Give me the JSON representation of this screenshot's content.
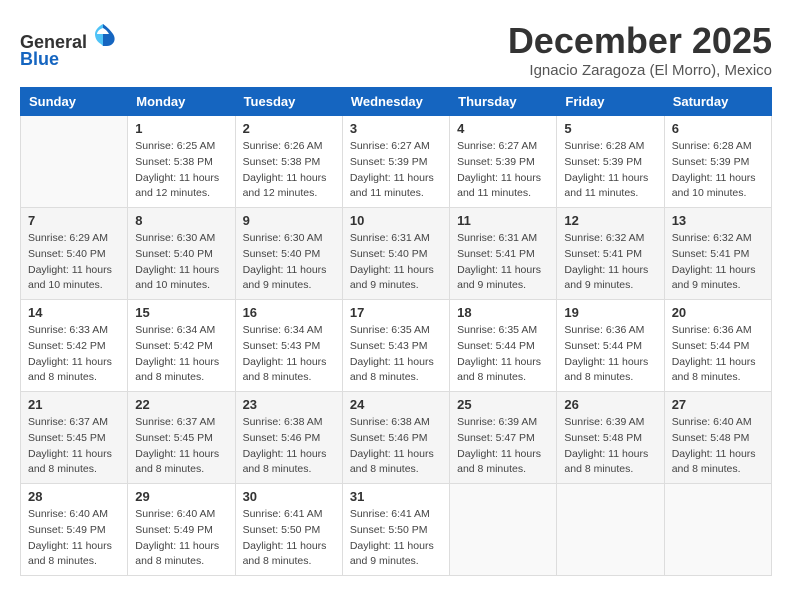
{
  "logo": {
    "text_general": "General",
    "text_blue": "Blue"
  },
  "header": {
    "month_title": "December 2025",
    "subtitle": "Ignacio Zaragoza (El Morro), Mexico"
  },
  "weekdays": [
    "Sunday",
    "Monday",
    "Tuesday",
    "Wednesday",
    "Thursday",
    "Friday",
    "Saturday"
  ],
  "weeks": [
    [
      {
        "day": "",
        "sunrise": "",
        "sunset": "",
        "daylight": ""
      },
      {
        "day": "1",
        "sunrise": "Sunrise: 6:25 AM",
        "sunset": "Sunset: 5:38 PM",
        "daylight": "Daylight: 11 hours and 12 minutes."
      },
      {
        "day": "2",
        "sunrise": "Sunrise: 6:26 AM",
        "sunset": "Sunset: 5:38 PM",
        "daylight": "Daylight: 11 hours and 12 minutes."
      },
      {
        "day": "3",
        "sunrise": "Sunrise: 6:27 AM",
        "sunset": "Sunset: 5:39 PM",
        "daylight": "Daylight: 11 hours and 11 minutes."
      },
      {
        "day": "4",
        "sunrise": "Sunrise: 6:27 AM",
        "sunset": "Sunset: 5:39 PM",
        "daylight": "Daylight: 11 hours and 11 minutes."
      },
      {
        "day": "5",
        "sunrise": "Sunrise: 6:28 AM",
        "sunset": "Sunset: 5:39 PM",
        "daylight": "Daylight: 11 hours and 11 minutes."
      },
      {
        "day": "6",
        "sunrise": "Sunrise: 6:28 AM",
        "sunset": "Sunset: 5:39 PM",
        "daylight": "Daylight: 11 hours and 10 minutes."
      }
    ],
    [
      {
        "day": "7",
        "sunrise": "Sunrise: 6:29 AM",
        "sunset": "Sunset: 5:40 PM",
        "daylight": "Daylight: 11 hours and 10 minutes."
      },
      {
        "day": "8",
        "sunrise": "Sunrise: 6:30 AM",
        "sunset": "Sunset: 5:40 PM",
        "daylight": "Daylight: 11 hours and 10 minutes."
      },
      {
        "day": "9",
        "sunrise": "Sunrise: 6:30 AM",
        "sunset": "Sunset: 5:40 PM",
        "daylight": "Daylight: 11 hours and 9 minutes."
      },
      {
        "day": "10",
        "sunrise": "Sunrise: 6:31 AM",
        "sunset": "Sunset: 5:40 PM",
        "daylight": "Daylight: 11 hours and 9 minutes."
      },
      {
        "day": "11",
        "sunrise": "Sunrise: 6:31 AM",
        "sunset": "Sunset: 5:41 PM",
        "daylight": "Daylight: 11 hours and 9 minutes."
      },
      {
        "day": "12",
        "sunrise": "Sunrise: 6:32 AM",
        "sunset": "Sunset: 5:41 PM",
        "daylight": "Daylight: 11 hours and 9 minutes."
      },
      {
        "day": "13",
        "sunrise": "Sunrise: 6:32 AM",
        "sunset": "Sunset: 5:41 PM",
        "daylight": "Daylight: 11 hours and 9 minutes."
      }
    ],
    [
      {
        "day": "14",
        "sunrise": "Sunrise: 6:33 AM",
        "sunset": "Sunset: 5:42 PM",
        "daylight": "Daylight: 11 hours and 8 minutes."
      },
      {
        "day": "15",
        "sunrise": "Sunrise: 6:34 AM",
        "sunset": "Sunset: 5:42 PM",
        "daylight": "Daylight: 11 hours and 8 minutes."
      },
      {
        "day": "16",
        "sunrise": "Sunrise: 6:34 AM",
        "sunset": "Sunset: 5:43 PM",
        "daylight": "Daylight: 11 hours and 8 minutes."
      },
      {
        "day": "17",
        "sunrise": "Sunrise: 6:35 AM",
        "sunset": "Sunset: 5:43 PM",
        "daylight": "Daylight: 11 hours and 8 minutes."
      },
      {
        "day": "18",
        "sunrise": "Sunrise: 6:35 AM",
        "sunset": "Sunset: 5:44 PM",
        "daylight": "Daylight: 11 hours and 8 minutes."
      },
      {
        "day": "19",
        "sunrise": "Sunrise: 6:36 AM",
        "sunset": "Sunset: 5:44 PM",
        "daylight": "Daylight: 11 hours and 8 minutes."
      },
      {
        "day": "20",
        "sunrise": "Sunrise: 6:36 AM",
        "sunset": "Sunset: 5:44 PM",
        "daylight": "Daylight: 11 hours and 8 minutes."
      }
    ],
    [
      {
        "day": "21",
        "sunrise": "Sunrise: 6:37 AM",
        "sunset": "Sunset: 5:45 PM",
        "daylight": "Daylight: 11 hours and 8 minutes."
      },
      {
        "day": "22",
        "sunrise": "Sunrise: 6:37 AM",
        "sunset": "Sunset: 5:45 PM",
        "daylight": "Daylight: 11 hours and 8 minutes."
      },
      {
        "day": "23",
        "sunrise": "Sunrise: 6:38 AM",
        "sunset": "Sunset: 5:46 PM",
        "daylight": "Daylight: 11 hours and 8 minutes."
      },
      {
        "day": "24",
        "sunrise": "Sunrise: 6:38 AM",
        "sunset": "Sunset: 5:46 PM",
        "daylight": "Daylight: 11 hours and 8 minutes."
      },
      {
        "day": "25",
        "sunrise": "Sunrise: 6:39 AM",
        "sunset": "Sunset: 5:47 PM",
        "daylight": "Daylight: 11 hours and 8 minutes."
      },
      {
        "day": "26",
        "sunrise": "Sunrise: 6:39 AM",
        "sunset": "Sunset: 5:48 PM",
        "daylight": "Daylight: 11 hours and 8 minutes."
      },
      {
        "day": "27",
        "sunrise": "Sunrise: 6:40 AM",
        "sunset": "Sunset: 5:48 PM",
        "daylight": "Daylight: 11 hours and 8 minutes."
      }
    ],
    [
      {
        "day": "28",
        "sunrise": "Sunrise: 6:40 AM",
        "sunset": "Sunset: 5:49 PM",
        "daylight": "Daylight: 11 hours and 8 minutes."
      },
      {
        "day": "29",
        "sunrise": "Sunrise: 6:40 AM",
        "sunset": "Sunset: 5:49 PM",
        "daylight": "Daylight: 11 hours and 8 minutes."
      },
      {
        "day": "30",
        "sunrise": "Sunrise: 6:41 AM",
        "sunset": "Sunset: 5:50 PM",
        "daylight": "Daylight: 11 hours and 8 minutes."
      },
      {
        "day": "31",
        "sunrise": "Sunrise: 6:41 AM",
        "sunset": "Sunset: 5:50 PM",
        "daylight": "Daylight: 11 hours and 9 minutes."
      },
      {
        "day": "",
        "sunrise": "",
        "sunset": "",
        "daylight": ""
      },
      {
        "day": "",
        "sunrise": "",
        "sunset": "",
        "daylight": ""
      },
      {
        "day": "",
        "sunrise": "",
        "sunset": "",
        "daylight": ""
      }
    ]
  ]
}
